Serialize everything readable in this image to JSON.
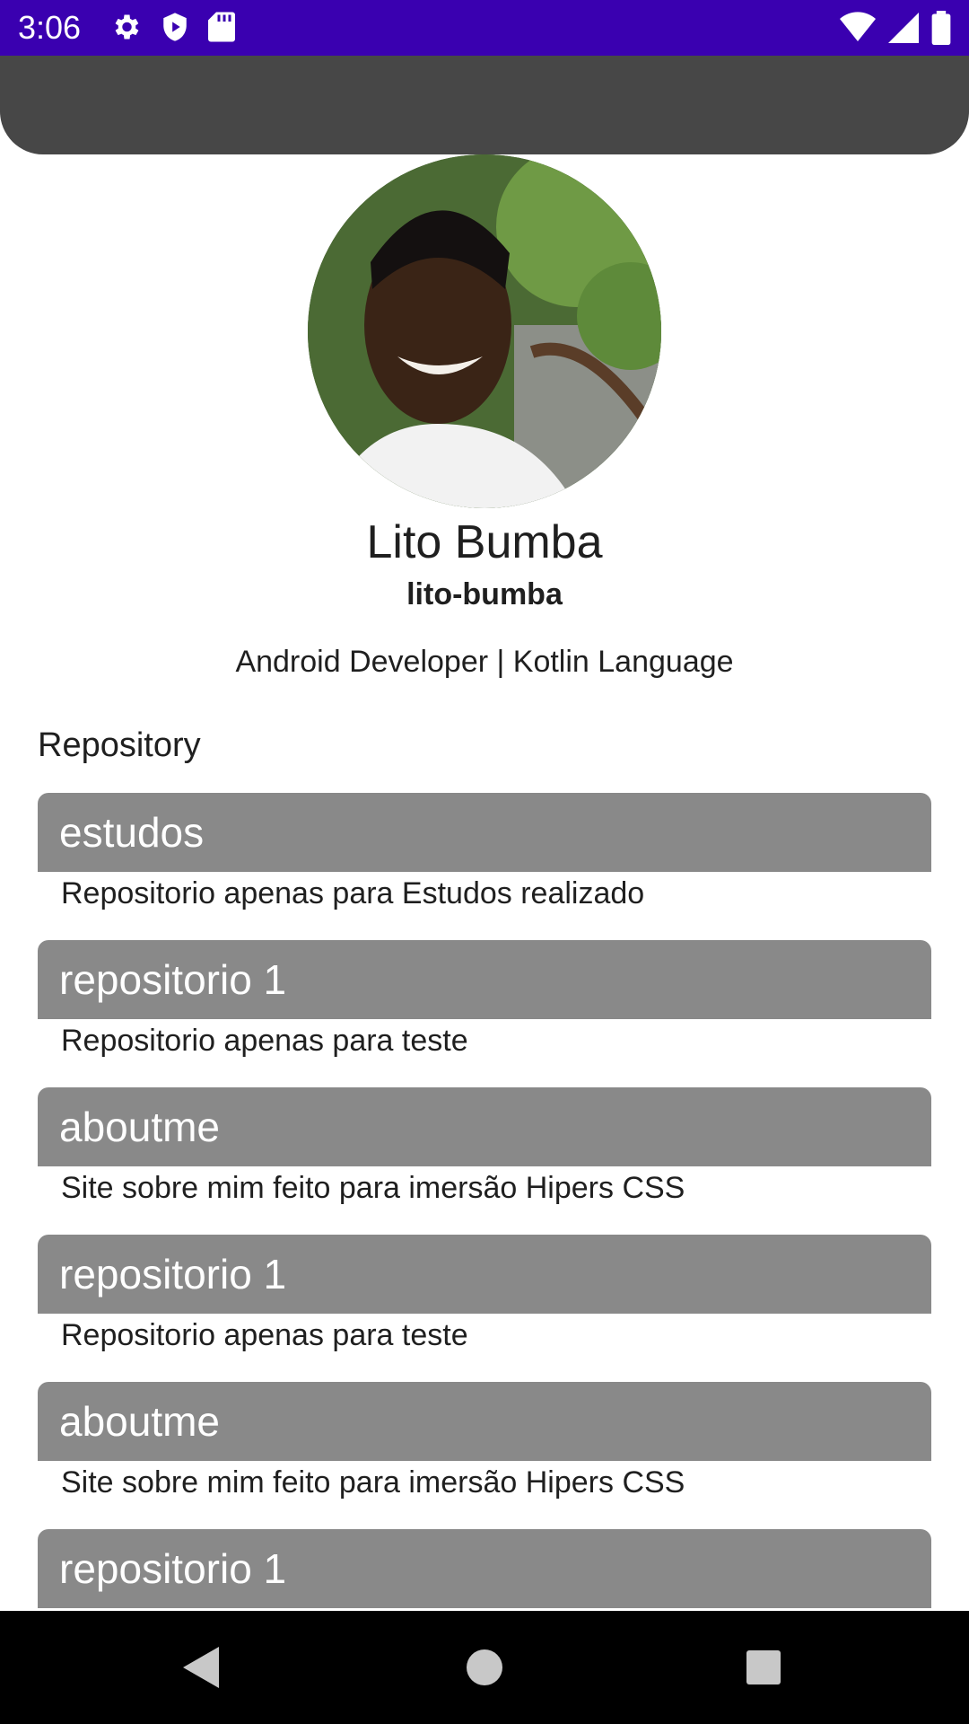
{
  "status_bar": {
    "time": "3:06",
    "left_icons": [
      "gear-icon",
      "shield-play-icon",
      "sd-card-icon"
    ],
    "right_icons": [
      "wifi-icon",
      "signal-icon",
      "battery-icon"
    ],
    "color": "#3a00b0"
  },
  "app_bar": {
    "color": "#474747"
  },
  "profile": {
    "name": "Lito Bumba",
    "login": "lito-bumba",
    "bio": "Android Developer | Kotlin Language"
  },
  "section_title": "Repository",
  "repositories": [
    {
      "name": "estudos",
      "description": "Repositorio apenas para Estudos realizado"
    },
    {
      "name": "repositorio 1",
      "description": "Repositorio apenas para teste"
    },
    {
      "name": "aboutme",
      "description": "Site sobre mim feito para imersão Hipers CSS"
    },
    {
      "name": "repositorio 1",
      "description": "Repositorio apenas para teste"
    },
    {
      "name": "aboutme",
      "description": "Site sobre mim feito para imersão Hipers CSS"
    },
    {
      "name": "repositorio 1",
      "description": ""
    }
  ],
  "nav_bar": {
    "buttons": [
      "back-icon",
      "home-icon",
      "recents-icon"
    ]
  },
  "colors": {
    "repo_header": "#898989",
    "text": "#1f1f1f"
  }
}
